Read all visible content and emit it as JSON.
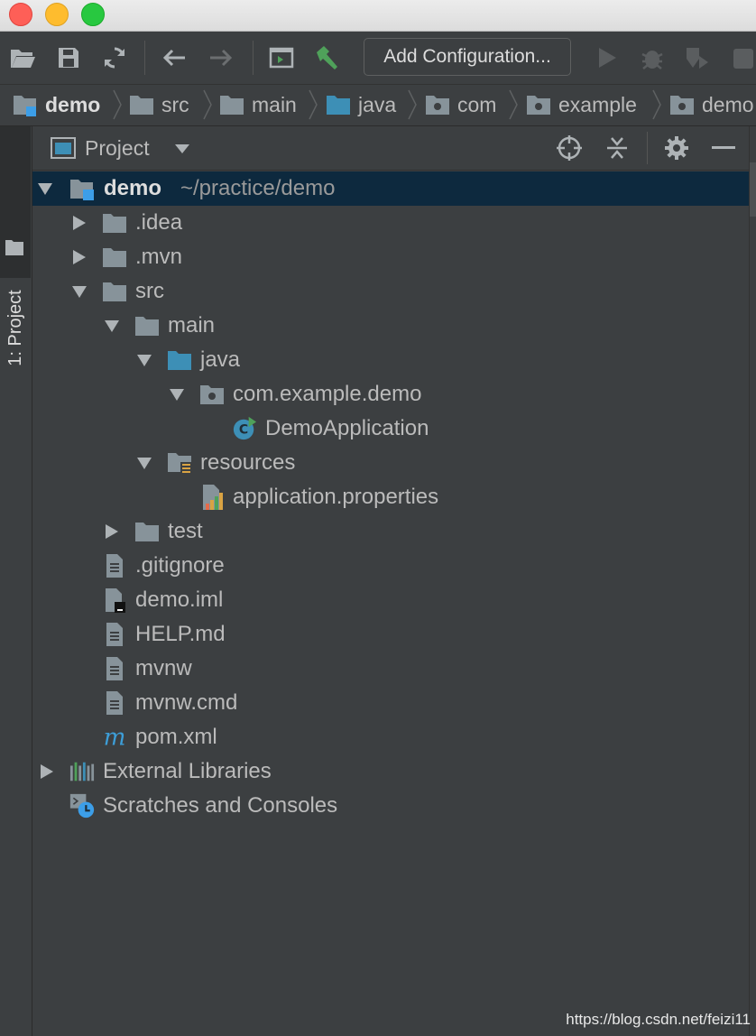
{
  "toolbar": {
    "config_label": "Add Configuration..."
  },
  "breadcrumb": [
    "demo",
    "src",
    "main",
    "java",
    "com",
    "example",
    "demo"
  ],
  "sidebar": {
    "tab_label": "1: Project"
  },
  "panel": {
    "title": "Project"
  },
  "tree": {
    "root_label": "demo",
    "root_path": "~/practice/demo",
    "idea": ".idea",
    "mvn": ".mvn",
    "src": "src",
    "main": "main",
    "java": "java",
    "package": "com.example.demo",
    "demo_app": "DemoApplication",
    "resources": "resources",
    "app_props": "application.properties",
    "test": "test",
    "gitignore": ".gitignore",
    "demo_iml": "demo.iml",
    "help_md": "HELP.md",
    "mvnw": "mvnw",
    "mvnw_cmd": "mvnw.cmd",
    "pom": "pom.xml",
    "ext_libs": "External Libraries",
    "scratches": "Scratches and Consoles"
  },
  "watermark": "https://blog.csdn.net/feizi11",
  "colors": {
    "selection": "#0d293e",
    "folder": "#87939a",
    "source_folder": "#3d8fb6",
    "accent_green": "#4fa15a"
  }
}
